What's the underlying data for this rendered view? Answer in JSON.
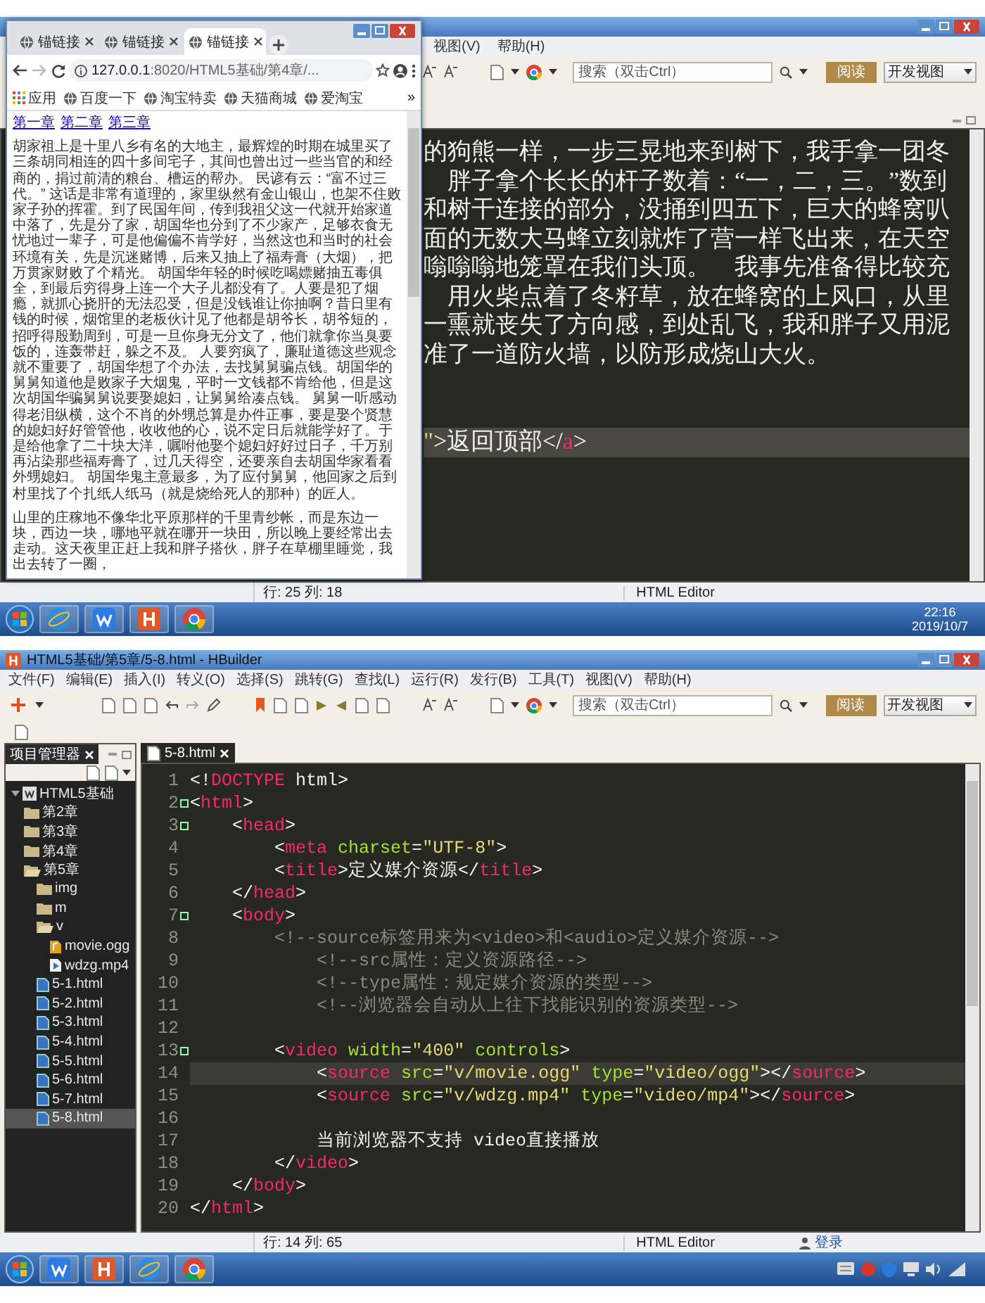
{
  "top_capture": {
    "editor_window": {
      "menu": [
        "视图(V)",
        "帮助(H)"
      ],
      "search": {
        "placeholder": "搜索（双击Ctrl）"
      },
      "read_button": "阅读",
      "view_select": "开发视图",
      "lines": [
        {
          "current": false,
          "tokens": [
            {
              "kind": "text",
              "text": "的狗熊一样，一步三晃地来到树下，我手拿一团冬"
            }
          ]
        },
        {
          "current": false,
          "tokens": [
            {
              "kind": "text",
              "text": "　胖子拿个长长的杆子数着：“一，二，三。”数到"
            }
          ]
        },
        {
          "current": false,
          "tokens": [
            {
              "kind": "text",
              "text": "和树干连接的部分，没捅到四五下，巨大的蜂窝叭"
            }
          ]
        },
        {
          "current": false,
          "tokens": [
            {
              "kind": "text",
              "text": "面的无数大马蜂立刻就炸了营一样飞出来，在天空"
            }
          ]
        },
        {
          "current": false,
          "tokens": [
            {
              "kind": "text",
              "text": "嗡嗡嗡地笼罩在我们头顶。　我事先准备得比较充"
            }
          ]
        },
        {
          "current": false,
          "tokens": [
            {
              "kind": "text",
              "text": "　用火柴点着了冬籽草，放在蜂窝的上风口，从里"
            }
          ]
        },
        {
          "current": false,
          "tokens": [
            {
              "kind": "text",
              "text": "一熏就丧失了方向感，到处乱飞，我和胖子又用泥"
            }
          ]
        },
        {
          "current": false,
          "tokens": [
            {
              "kind": "text",
              "text": "准了一道防火墙，以防形成烧山大火。"
            }
          ]
        },
        {
          "current": true,
          "tokens": [
            {
              "kind": "str",
              "text": "\""
            },
            {
              "kind": "p",
              "text": ">"
            },
            {
              "kind": "text",
              "text": "返回顶部"
            },
            {
              "kind": "p",
              "text": "</"
            },
            {
              "kind": "tag",
              "text": "a"
            },
            {
              "kind": "p",
              "text": ">"
            }
          ]
        }
      ],
      "status": {
        "position": "行: 25 列: 18",
        "mode": "HTML Editor"
      }
    },
    "browser": {
      "tabs": [
        {
          "label": "锚链接",
          "selected": false
        },
        {
          "label": "锚链接",
          "selected": false
        },
        {
          "label": "锚链接",
          "selected": true
        }
      ],
      "address": "**127.0.0.1**:8020/HTML5基础/第4章/...",
      "bookmarks": [
        {
          "kind": "apps",
          "label": "应用"
        },
        {
          "kind": "site",
          "label": "百度一下"
        },
        {
          "kind": "site",
          "label": "淘宝特卖"
        },
        {
          "kind": "site",
          "label": "天猫商城"
        },
        {
          "kind": "site",
          "label": "爱淘宝"
        }
      ],
      "bookmarks_more": "»",
      "chapter_links": [
        "第一章",
        "第二章",
        "第三章"
      ],
      "paragraphs": [
        "胡家祖上是十里八乡有名的大地主，最辉煌的时期在城里买了三条胡同相连的四十多间宅子，其间也曾出过一些当官的和经商的，捐过前清的粮台、槽运的帮办。 民谚有云：“富不过三代。” 这话是非常有道理的，家里纵然有金山银山，也架不住败家子孙的挥霍。到了民国年间，传到我祖父这一代就开始家道中落了，先是分了家，胡国华也分到了不少家产，足够衣食无忧地过一辈子，可是他偏偏不肯学好，当然这也和当时的社会环境有关，先是沉迷赌博，后来又抽上了福寿膏（大烟），把万贯家财败了个精光。 胡国华年轻的时候吃喝嫖赌抽五毒俱全，到最后穷得身上连一个大子儿都没有了。人要是犯了烟瘾，就抓心挠肝的无法忍受，但是没钱谁让你抽啊？昔日里有钱的时候，烟馆里的老板伙计见了他都是胡爷长，胡爷短的，招呼得殷勤周到，可是一旦你身无分文了，他们就拿你当臭要饭的，连轰带赶，躲之不及。 人要穷疯了，廉耻道德这些观念就不重要了，胡国华想了个办法，去找舅舅骗点钱。胡国华的舅舅知道他是败家子大烟鬼，平时一文钱都不肯给他，但是这次胡国华骗舅舅说要娶媳妇，让舅舅给凑点钱。 舅舅一听感动得老泪纵横，这个不肖的外甥总算是办件正事，要是娶个贤慧的媳妇好好管管他，收收他的心，说不定日后就能学好了。于是给他拿了二十块大洋，嘱咐他娶个媳妇好好过日子，千万别再沾染那些福寿膏了，过几天得空，还要亲自去胡国华家看看外甥媳妇。 胡国华鬼主意最多，为了应付舅舅，他回家之后到村里找了个扎纸人纸马（就是烧给死人的那种）的匠人。",
        "山里的庄稼地不像华北平原那样的千里青纱帐，而是东边一块，西边一块，哪地平就在哪开一块田，所以晚上要经常出去走动。这天夜里正赶上我和胖子搭伙，胖子在草棚里睡觉，我出去转了一圈，"
      ]
    },
    "taskbar": {
      "apps": [
        {
          "kind": "ie"
        },
        {
          "kind": "wps"
        },
        {
          "kind": "hbuilder"
        },
        {
          "kind": "chrome"
        }
      ],
      "time": "22:16",
      "date": "2019/10/7"
    }
  },
  "bottom_capture": {
    "editor_window": {
      "title": "HTML5基础/第5章/5-8.html - HBuilder",
      "menu": [
        "文件(F)",
        "编辑(E)",
        "插入(I)",
        "转义(O)",
        "选择(S)",
        "跳转(G)",
        "查找(L)",
        "运行(R)",
        "发行(B)",
        "工具(T)",
        "视图(V)",
        "帮助(H)"
      ],
      "search": {
        "placeholder": "搜索（双击Ctrl）"
      },
      "read_button": "阅读",
      "view_select": "开发视图",
      "project_panel": {
        "title": "项目管理器",
        "tree": [
          {
            "label": "HTML5基础",
            "kind": "project",
            "expanded": true,
            "selected": false,
            "children": [
              {
                "label": "第2章",
                "kind": "folder",
                "expanded": false,
                "selected": false
              },
              {
                "label": "第3章",
                "kind": "folder",
                "expanded": false,
                "selected": false
              },
              {
                "label": "第4章",
                "kind": "folder",
                "expanded": false,
                "selected": false
              },
              {
                "label": "第5章",
                "kind": "folder",
                "expanded": true,
                "selected": false,
                "children": [
                  {
                    "label": "img",
                    "kind": "folder",
                    "expanded": false,
                    "selected": false
                  },
                  {
                    "label": "m",
                    "kind": "folder",
                    "expanded": false,
                    "selected": false
                  },
                  {
                    "label": "v",
                    "kind": "folder",
                    "expanded": true,
                    "selected": false,
                    "children": [
                      {
                        "label": "movie.ogg",
                        "kind": "audio",
                        "selected": false
                      },
                      {
                        "label": "wdzg.mp4",
                        "kind": "video",
                        "selected": false
                      }
                    ]
                  },
                  {
                    "label": "5-1.html",
                    "kind": "html",
                    "selected": false
                  },
                  {
                    "label": "5-2.html",
                    "kind": "html",
                    "selected": false
                  },
                  {
                    "label": "5-3.html",
                    "kind": "html",
                    "selected": false
                  },
                  {
                    "label": "5-4.html",
                    "kind": "html",
                    "selected": false
                  },
                  {
                    "label": "5-5.html",
                    "kind": "html",
                    "selected": false
                  },
                  {
                    "label": "5-6.html",
                    "kind": "html",
                    "selected": false
                  },
                  {
                    "label": "5-7.html",
                    "kind": "html",
                    "selected": false
                  },
                  {
                    "label": "5-8.html",
                    "kind": "html",
                    "selected": true
                  }
                ]
              }
            ]
          }
        ]
      },
      "editor_tab": "5-8.html",
      "lines": [
        {
          "number": "1",
          "fold": false,
          "current": false,
          "tokens": [
            {
              "kind": "p",
              "text": "<!"
            },
            {
              "kind": "tag",
              "text": "DOCTYPE"
            },
            {
              "kind": "text",
              "text": " html"
            },
            {
              "kind": "p",
              "text": ">"
            }
          ]
        },
        {
          "number": "2",
          "fold": true,
          "current": false,
          "tokens": [
            {
              "kind": "p",
              "text": "<"
            },
            {
              "kind": "tag",
              "text": "html"
            },
            {
              "kind": "p",
              "text": ">"
            }
          ]
        },
        {
          "number": "3",
          "fold": true,
          "current": false,
          "tokens": [
            {
              "kind": "p",
              "text": "    <"
            },
            {
              "kind": "tag",
              "text": "head"
            },
            {
              "kind": "p",
              "text": ">"
            }
          ]
        },
        {
          "number": "4",
          "fold": false,
          "current": false,
          "tokens": [
            {
              "kind": "p",
              "text": "        <"
            },
            {
              "kind": "tag",
              "text": "meta"
            },
            {
              "kind": "attr",
              "text": " charset"
            },
            {
              "kind": "p",
              "text": "="
            },
            {
              "kind": "str",
              "text": "\"UTF-8\""
            },
            {
              "kind": "p",
              "text": ">"
            }
          ]
        },
        {
          "number": "5",
          "fold": false,
          "current": false,
          "tokens": [
            {
              "kind": "p",
              "text": "        <"
            },
            {
              "kind": "tag",
              "text": "title"
            },
            {
              "kind": "p",
              "text": ">"
            },
            {
              "kind": "text",
              "text": "定义媒介资源"
            },
            {
              "kind": "p",
              "text": "</"
            },
            {
              "kind": "tag",
              "text": "title"
            },
            {
              "kind": "p",
              "text": ">"
            }
          ]
        },
        {
          "number": "6",
          "fold": false,
          "current": false,
          "tokens": [
            {
              "kind": "p",
              "text": "    </"
            },
            {
              "kind": "tag",
              "text": "head"
            },
            {
              "kind": "p",
              "text": ">"
            }
          ]
        },
        {
          "number": "7",
          "fold": true,
          "current": false,
          "tokens": [
            {
              "kind": "p",
              "text": "    <"
            },
            {
              "kind": "tag",
              "text": "body"
            },
            {
              "kind": "p",
              "text": ">"
            }
          ]
        },
        {
          "number": "8",
          "fold": false,
          "current": false,
          "tokens": [
            {
              "kind": "cmt",
              "text": "        <!--source标签用来为<video>和<audio>定义媒介资源-->"
            }
          ]
        },
        {
          "number": "9",
          "fold": false,
          "current": false,
          "tokens": [
            {
              "kind": "cmt",
              "text": "            <!--src属性：定义资源路径-->"
            }
          ]
        },
        {
          "number": "10",
          "fold": false,
          "current": false,
          "tokens": [
            {
              "kind": "cmt",
              "text": "            <!--type属性：规定媒介资源的类型-->"
            }
          ]
        },
        {
          "number": "11",
          "fold": false,
          "current": false,
          "tokens": [
            {
              "kind": "cmt",
              "text": "            <!--浏览器会自动从上往下找能识别的资源类型-->"
            }
          ]
        },
        {
          "number": "12",
          "fold": false,
          "current": false
        },
        {
          "number": "13",
          "fold": true,
          "current": false,
          "tokens": [
            {
              "kind": "p",
              "text": "        <"
            },
            {
              "kind": "tag",
              "text": "video"
            },
            {
              "kind": "attr",
              "text": " width"
            },
            {
              "kind": "p",
              "text": "="
            },
            {
              "kind": "str",
              "text": "\"400\""
            },
            {
              "kind": "attr",
              "text": " controls"
            },
            {
              "kind": "p",
              "text": ">"
            }
          ]
        },
        {
          "number": "14",
          "fold": false,
          "current": true,
          "tokens": [
            {
              "kind": "p",
              "text": "            <"
            },
            {
              "kind": "tag",
              "text": "source"
            },
            {
              "kind": "attr",
              "text": " src"
            },
            {
              "kind": "p",
              "text": "="
            },
            {
              "kind": "str",
              "text": "\"v/movie.ogg\""
            },
            {
              "kind": "attr",
              "text": " type"
            },
            {
              "kind": "p",
              "text": "="
            },
            {
              "kind": "str",
              "text": "\"video/ogg\""
            },
            {
              "kind": "p",
              "text": "></"
            },
            {
              "kind": "tag",
              "text": "source"
            },
            {
              "kind": "p",
              "text": ">"
            }
          ]
        },
        {
          "number": "15",
          "fold": false,
          "current": false,
          "tokens": [
            {
              "kind": "p",
              "text": "            <"
            },
            {
              "kind": "tag",
              "text": "source"
            },
            {
              "kind": "attr",
              "text": " src"
            },
            {
              "kind": "p",
              "text": "="
            },
            {
              "kind": "str",
              "text": "\"v/wdzg.mp4\""
            },
            {
              "kind": "attr",
              "text": " type"
            },
            {
              "kind": "p",
              "text": "="
            },
            {
              "kind": "str",
              "text": "\"video/mp4\""
            },
            {
              "kind": "p",
              "text": "></"
            },
            {
              "kind": "tag",
              "text": "source"
            },
            {
              "kind": "p",
              "text": ">"
            }
          ]
        },
        {
          "number": "16",
          "fold": false,
          "current": false
        },
        {
          "number": "17",
          "fold": false,
          "current": false,
          "tokens": [
            {
              "kind": "text",
              "text": "            当前浏览器不支持 video直接播放"
            }
          ]
        },
        {
          "number": "18",
          "fold": false,
          "current": false,
          "tokens": [
            {
              "kind": "p",
              "text": "        </"
            },
            {
              "kind": "tag",
              "text": "video"
            },
            {
              "kind": "p",
              "text": ">"
            }
          ]
        },
        {
          "number": "19",
          "fold": false,
          "current": false,
          "tokens": [
            {
              "kind": "p",
              "text": "    </"
            },
            {
              "kind": "tag",
              "text": "body"
            },
            {
              "kind": "p",
              "text": ">"
            }
          ]
        },
        {
          "number": "20",
          "fold": false,
          "current": false,
          "tokens": [
            {
              "kind": "p",
              "text": "</"
            },
            {
              "kind": "tag",
              "text": "html"
            },
            {
              "kind": "p",
              "text": ">"
            }
          ]
        }
      ],
      "status": {
        "position": "行: 14 列: 65",
        "mode": "HTML Editor",
        "login": "登录"
      }
    },
    "taskbar": {
      "apps": [
        {
          "kind": "wps"
        },
        {
          "kind": "hbuilder"
        },
        {
          "kind": "ie"
        },
        {
          "kind": "chrome"
        }
      ]
    }
  }
}
